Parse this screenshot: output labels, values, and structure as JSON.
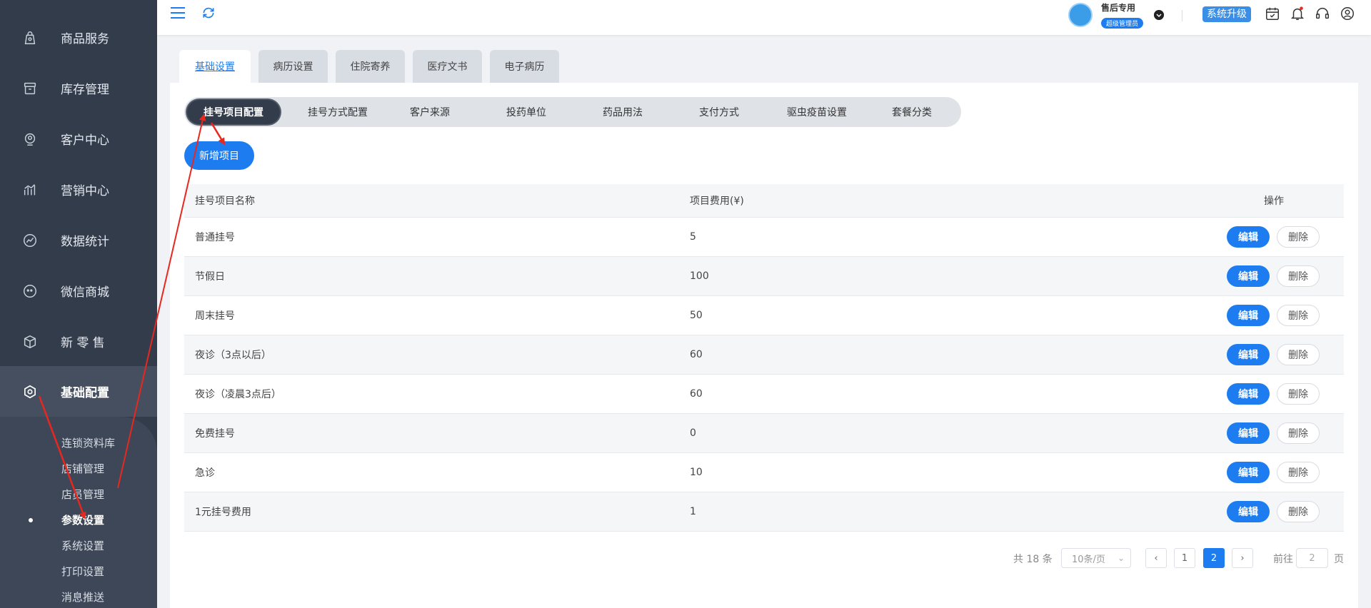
{
  "sidebar": {
    "items": [
      {
        "label": "商品服务",
        "icon": "bag-icon"
      },
      {
        "label": "库存管理",
        "icon": "box-icon"
      },
      {
        "label": "客户中心",
        "icon": "user-head-icon"
      },
      {
        "label": "营销中心",
        "icon": "chart-bars-icon"
      },
      {
        "label": "数据统计",
        "icon": "trend-icon"
      },
      {
        "label": "微信商城",
        "icon": "chat-icon"
      },
      {
        "label": "新 零 售",
        "icon": "cube-icon"
      },
      {
        "label": "基础配置",
        "icon": "settings-icon"
      }
    ],
    "sub_items": [
      "连锁资料库",
      "店铺管理",
      "店员管理",
      "参数设置",
      "系统设置",
      "打印设置",
      "消息推送"
    ],
    "active_sub": "参数设置"
  },
  "topbar": {
    "user_name": "售后专用",
    "user_role": "超级管理员",
    "upgrade_label": "系统升级"
  },
  "outer_tabs": [
    "基础设置",
    "病历设置",
    "住院寄养",
    "医疗文书",
    "电子病历"
  ],
  "inner_tabs": [
    "挂号项目配置",
    "挂号方式配置",
    "客户来源",
    "投药单位",
    "药品用法",
    "支付方式",
    "驱虫疫苗设置",
    "套餐分类"
  ],
  "add_button": "新增项目",
  "table": {
    "headers": [
      "挂号项目名称",
      "项目费用(¥)",
      "操作"
    ],
    "edit_label": "编辑",
    "delete_label": "删除",
    "rows": [
      {
        "name": "普通挂号",
        "fee": "5"
      },
      {
        "name": "节假日",
        "fee": "100"
      },
      {
        "name": "周末挂号",
        "fee": "50"
      },
      {
        "name": "夜诊（3点以后）",
        "fee": "60"
      },
      {
        "name": "夜诊（凌晨3点后）",
        "fee": "60"
      },
      {
        "name": "免费挂号",
        "fee": "0"
      },
      {
        "name": "急诊",
        "fee": "10"
      },
      {
        "name": "1元挂号费用",
        "fee": "1"
      }
    ]
  },
  "pager": {
    "total": "共 18 条",
    "page_size": "10条/页",
    "prev": "‹",
    "next": "›",
    "page1": "1",
    "page2": "2",
    "goto_label": "前往",
    "goto_value": "2",
    "goto_suffix": "页"
  },
  "colors": {
    "primary": "#1d7df0",
    "sidebar": "#333c4b",
    "annotation": "#e8271f"
  }
}
